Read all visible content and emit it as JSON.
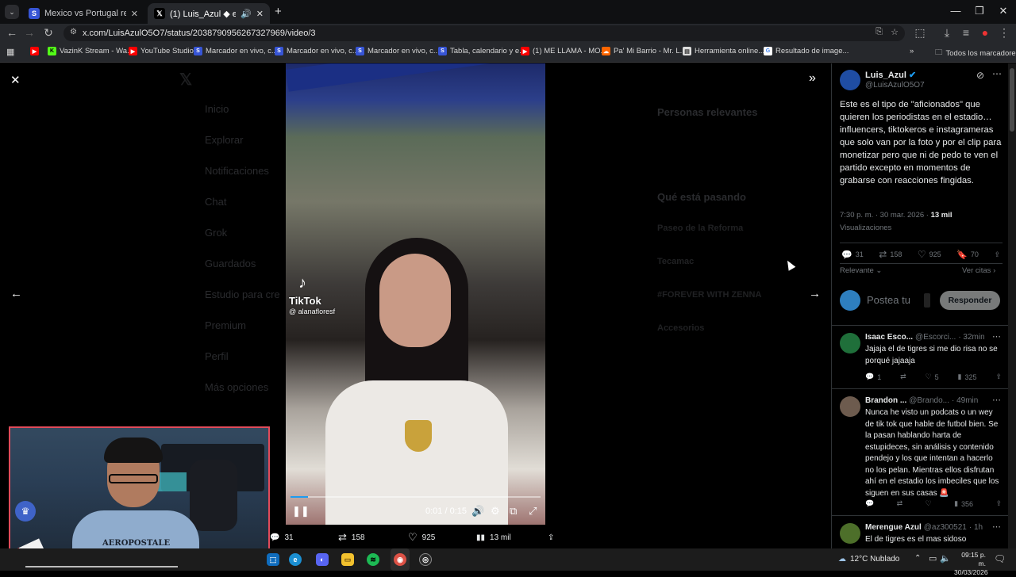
{
  "browser": {
    "tabs": [
      {
        "title": "Mexico vs Portugal resultados e",
        "active": false
      },
      {
        "title": "(1) Luis_Azul ◆ en X: \"Este",
        "active": true
      }
    ],
    "url": "x.com/LuisAzulO5O7/status/2038790956267327969/video/3",
    "bookmarks": [
      {
        "label": "",
        "icon": "youtube-icon"
      },
      {
        "label": "VazinK Stream - Wa...",
        "icon": "kick-icon"
      },
      {
        "label": "YouTube Studio",
        "icon": "youtube-icon"
      },
      {
        "label": "Marcador en vivo, c...",
        "icon": "sofascore-icon"
      },
      {
        "label": "Marcador en vivo, c...",
        "icon": "sofascore-icon"
      },
      {
        "label": "Marcador en vivo, c...",
        "icon": "sofascore-icon"
      },
      {
        "label": "Tabla, calendario y e...",
        "icon": "sofascore-icon"
      },
      {
        "label": "(1) ME LLAMA - MO...",
        "icon": "youtube-icon"
      },
      {
        "label": "Pa' Mi Barrio - Mr. L...",
        "icon": "soundcloud-icon"
      },
      {
        "label": "Herramienta online...",
        "icon": "doc-icon"
      },
      {
        "label": "Resultado de image...",
        "icon": "google-icon"
      }
    ],
    "all_bookmarks": "Todos los marcadores"
  },
  "background_nav": [
    "Inicio",
    "Explorar",
    "Notificaciones",
    "Chat",
    "Grok",
    "Guardados",
    "Estudio para cre",
    "Premium",
    "Perfil",
    "Más opciones"
  ],
  "background_right": {
    "relevant": "Personas relevantes",
    "whats_happening": "Qué está pasando",
    "items": [
      "Paseo de la Reforma",
      "Tecamac",
      "#FOREVER WITH ZENNA",
      "Accesorios"
    ]
  },
  "video": {
    "tiktok_label": "TikTok",
    "tiktok_handle": "@ alanafloresf",
    "time": "0:01 / 0:15",
    "progress": 0.07
  },
  "video_stats": {
    "replies": "31",
    "reposts": "158",
    "likes": "925",
    "views": "13 mil"
  },
  "tweet": {
    "name": "Luis_Azul",
    "handle": "@LuisAzulO5O7",
    "text": "Este es el tipo de \"aficionados\" que quieren los periodistas en el estadio… influencers, tiktokeros e instagrameras que solo van por la foto y por el clip para monetizar pero que ni de pedo te ven el partido excepto en momentos de grabarse con reacciones fingidas.",
    "time": "7:30 p. m. · 30 mar. 2026 ·",
    "views_count": "13 mil",
    "views_label": "Visualizaciones",
    "replies": "31",
    "reposts": "158",
    "likes": "925",
    "bookmarks": "70",
    "sort_label": "Relevante",
    "quotes_label": "Ver citas",
    "reply_placeholder": "Postea tu",
    "reply_button": "Responder"
  },
  "replies": [
    {
      "name": "Isaac Esco...",
      "handle": "@Escorci...",
      "time": "· 32min",
      "text": "Jajaja el de tigres si me dio risa no se porqué jajaaja",
      "comments": "1",
      "likes": "5",
      "views": "325"
    },
    {
      "name": "Brandon ...",
      "handle": "@Brando...",
      "time": "· 49min",
      "text": "Nunca he visto un podcats o un wey de tik tok que hable de futbol bien. Se la pasan hablando harta de estupideces, sin análisis y contenido pendejo y los que intentan a hacerlo no los pelan. Mientras ellos disfrutan ahí en el estadio los imbeciles que los siguen en sus casas 🚨",
      "comments": "",
      "likes": "",
      "views": "356"
    },
    {
      "name": "Merengue Azul",
      "handle": "@az300521",
      "time": "· 1h",
      "text": "El de tigres es el mas sidoso",
      "comments": "",
      "likes": "",
      "views": ""
    }
  ],
  "webcam": {
    "shirt_text": "AEROPOSTALE"
  },
  "taskbar": {
    "weather": "12°C  Nublado",
    "time": "09:15 p. m.",
    "date": "30/03/2026"
  }
}
